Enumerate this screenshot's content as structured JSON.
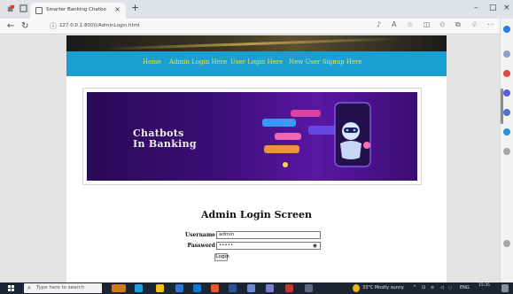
{
  "browser": {
    "tab_title": "Smarter Banking Chatbo",
    "url": "127.0.0.1:8000/AdminLogin.html",
    "new_tab_symbol": "+",
    "close_symbol": "×",
    "window_controls": [
      "–",
      "□",
      "×"
    ]
  },
  "nav": {
    "links": [
      "Home",
      "Admin Login Here",
      "User Login Here",
      "New User Signup Here"
    ]
  },
  "banner": {
    "title": "Chatbots\nIn Banking"
  },
  "login": {
    "title": "Admin Login Screen",
    "username_label": "Username",
    "username_value": "admin",
    "password_label": "Password",
    "password_value": "•••••",
    "button_label": "Login"
  },
  "taskbar": {
    "search_placeholder": "Type here to search",
    "weather": "33°C  Mostly sunny",
    "tray_lang": "ENG",
    "time": "15:35"
  },
  "colors": {
    "navbar": "#1a9fd3",
    "nav_link": "#f5e63b",
    "banner_purple": "#3c0e78",
    "taskbar": "#1c2533"
  }
}
